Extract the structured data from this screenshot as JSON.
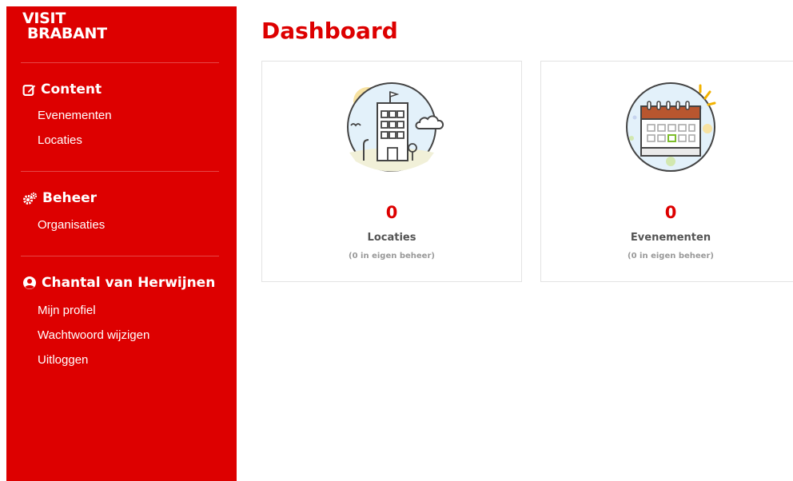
{
  "brand": {
    "line1": "VISIT",
    "line2": "BRABANT"
  },
  "sidebar": {
    "sections": [
      {
        "title": "Content",
        "icon": "edit-icon",
        "items": [
          {
            "label": "Evenementen"
          },
          {
            "label": "Locaties"
          }
        ]
      },
      {
        "title": "Beheer",
        "icon": "gears-icon",
        "items": [
          {
            "label": "Organisaties"
          }
        ]
      },
      {
        "title": "Chantal van Herwijnen",
        "icon": "user-circle-icon",
        "items": [
          {
            "label": "Mijn profiel"
          },
          {
            "label": "Wachtwoord wijzigen"
          },
          {
            "label": "Uitloggen"
          }
        ]
      }
    ]
  },
  "main": {
    "title": "Dashboard",
    "cards": [
      {
        "icon": "building-illustration",
        "count": "0",
        "label": "Locaties",
        "sub": "(0 in eigen beheer)"
      },
      {
        "icon": "calendar-illustration",
        "count": "0",
        "label": "Evenementen",
        "sub": "(0 in eigen beheer)"
      }
    ]
  },
  "colors": {
    "brand_red": "#dd0000",
    "card_border": "#e3e3e3",
    "text_gray": "#555555"
  }
}
